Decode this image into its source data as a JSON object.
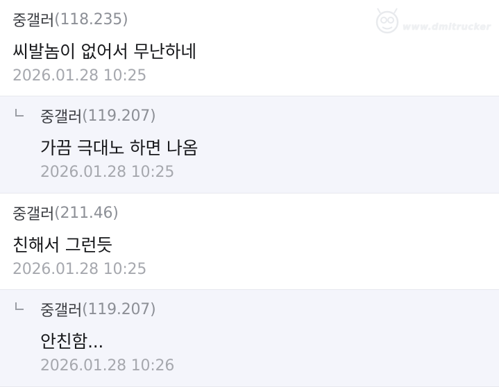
{
  "comments": [
    {
      "nickname": "중갤러",
      "ip": "(118.235)",
      "text": "씨발놈이 없어서 무난하네",
      "date": "2026.01.28 10:25",
      "is_reply": false
    },
    {
      "nickname": "중갤러",
      "ip": "(119.207)",
      "text": "가끔 극대노 하면 나옴",
      "date": "2026.01.28 10:25",
      "is_reply": true
    },
    {
      "nickname": "중갤러",
      "ip": "(211.46)",
      "text": "친해서 그런듯",
      "date": "2026.01.28 10:25",
      "is_reply": false
    },
    {
      "nickname": "중갤러",
      "ip": "(119.207)",
      "text": "안친함...",
      "date": "2026.01.28 10:26",
      "is_reply": true
    }
  ],
  "watermark": {
    "icon": "mascot-logo-icon",
    "text": "www.dmitrucker"
  },
  "colors": {
    "reply_background": "#f4f5fb",
    "nickname": "#3b3d42",
    "ip": "#8c8f96",
    "body_text": "#17181b",
    "date": "#a6a8ae"
  }
}
